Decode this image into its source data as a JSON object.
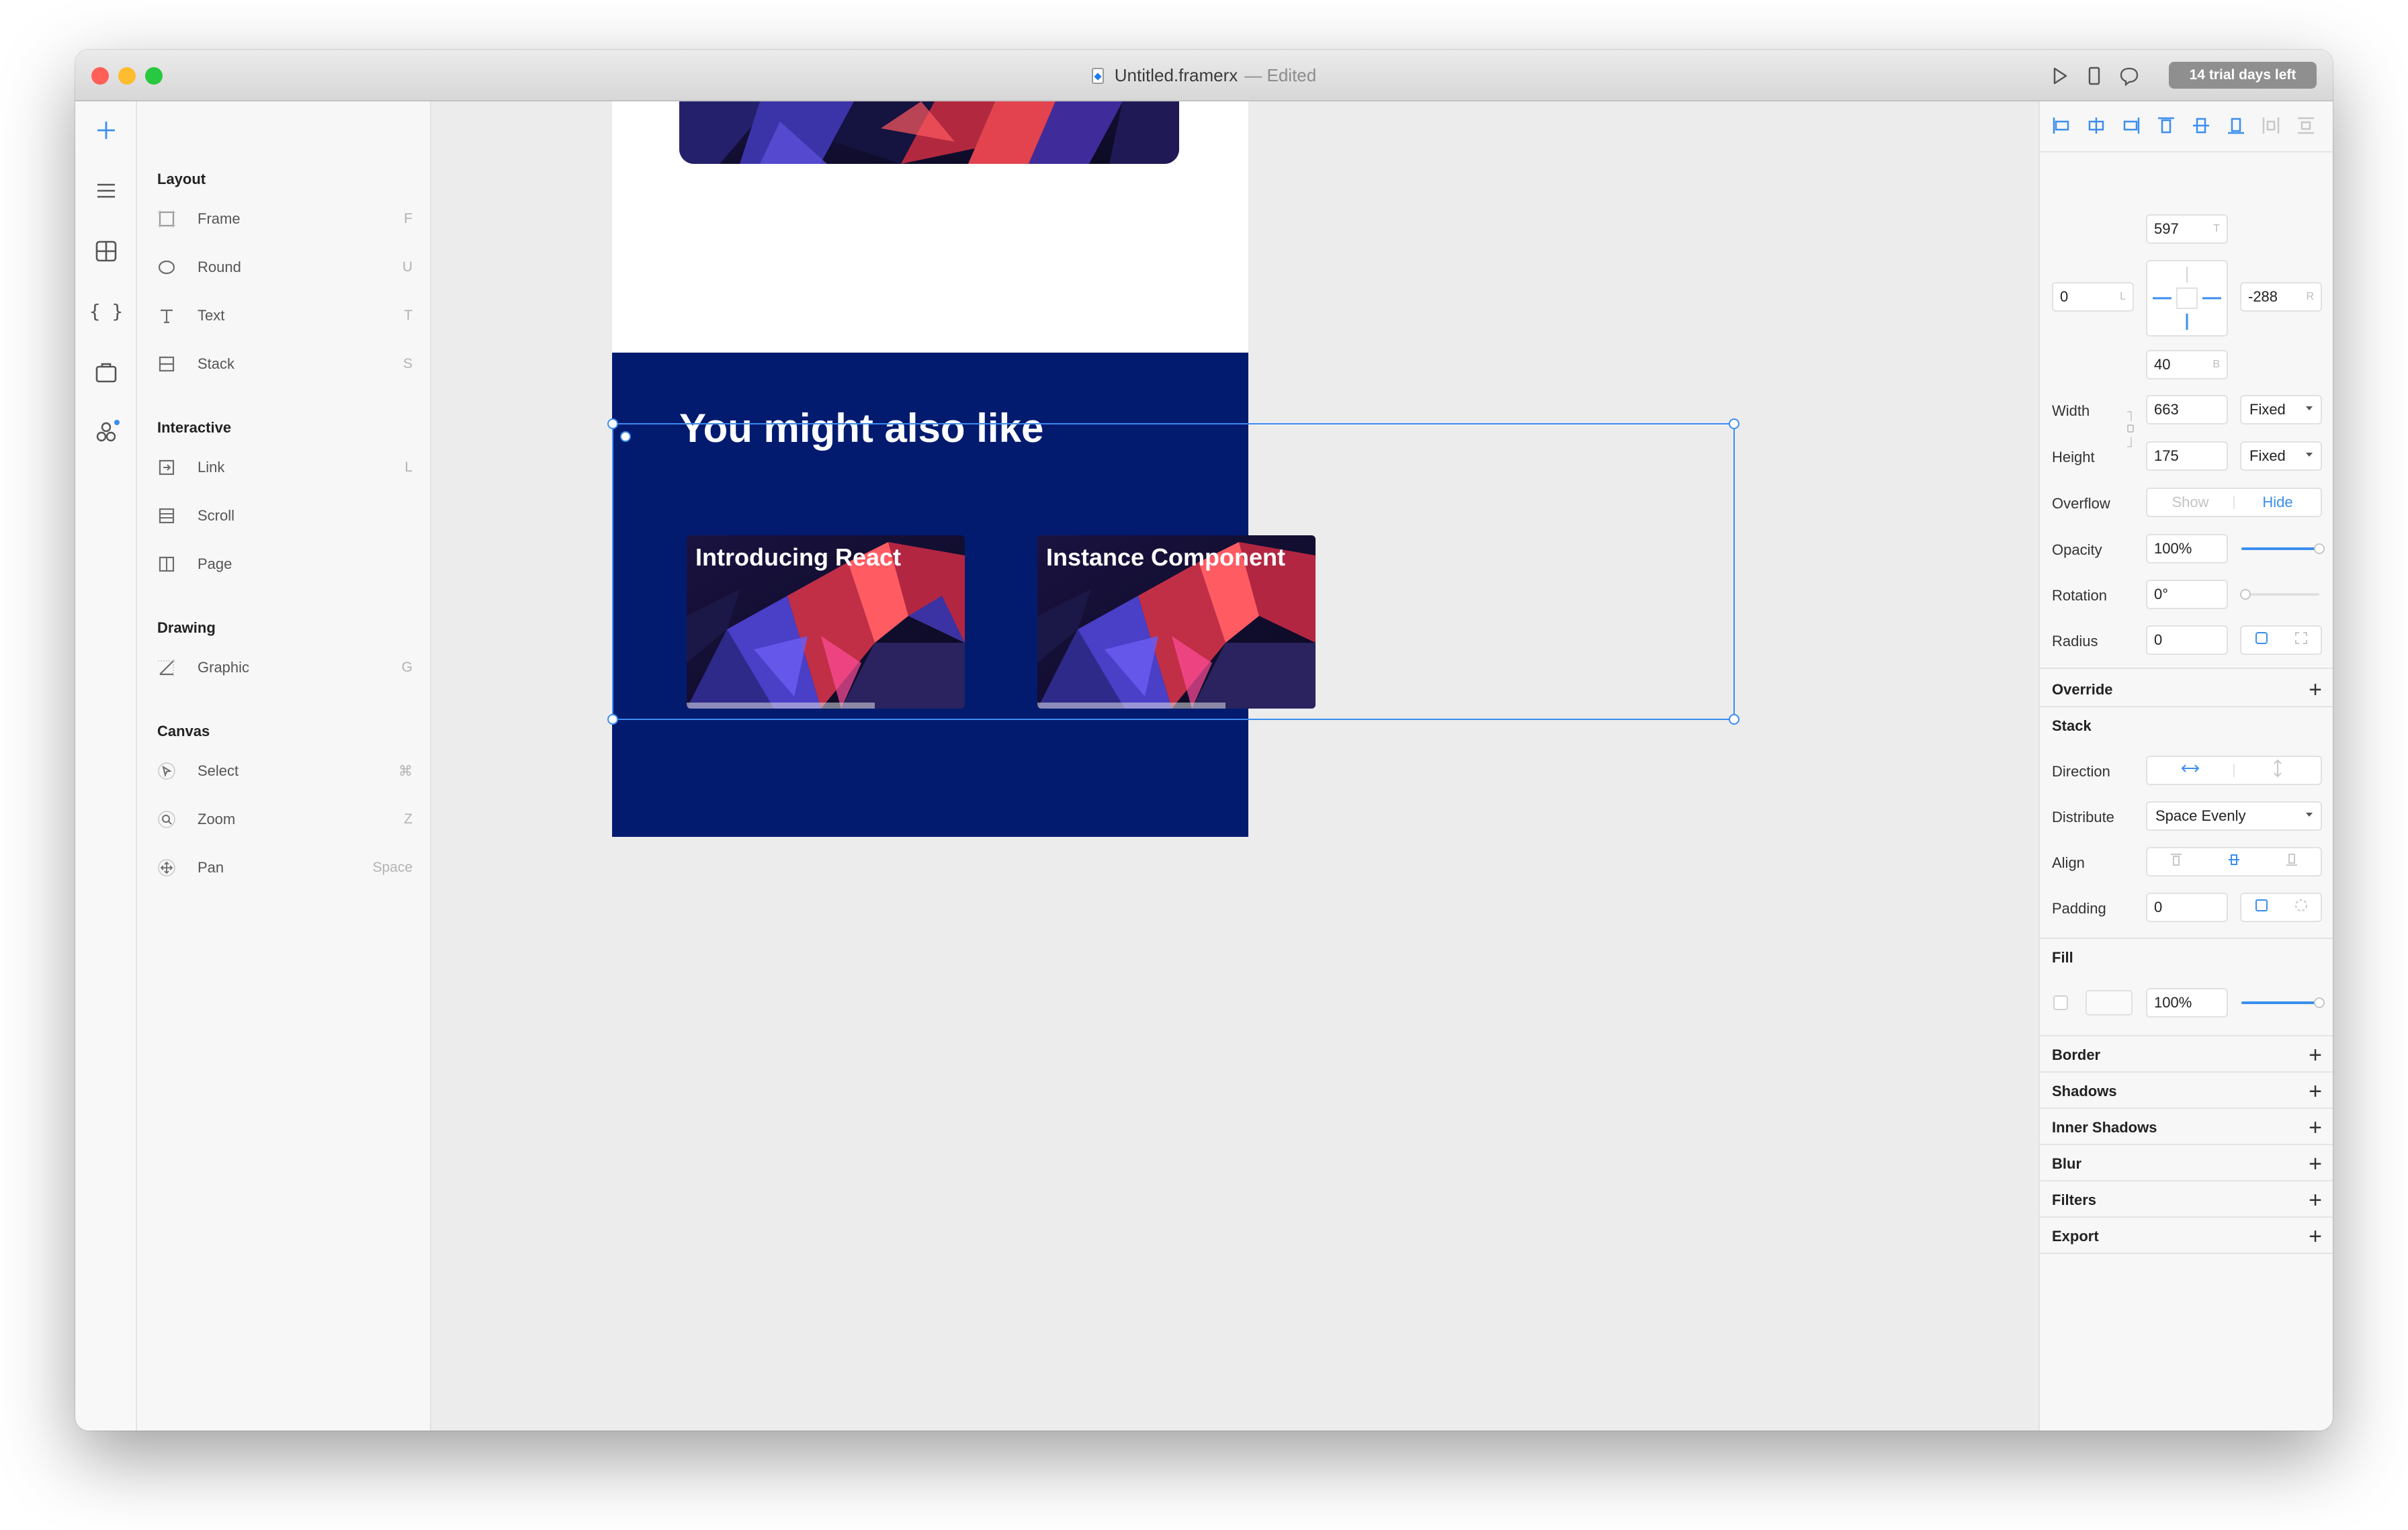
{
  "window": {
    "title": "Untitled.framerx",
    "title_suffix": "— Edited",
    "trial": "14 trial days left"
  },
  "toolbar_icons": [
    "play-icon",
    "device-icon",
    "comment-icon"
  ],
  "rail_icons": [
    "insert-icon",
    "layers-icon",
    "components-icon",
    "code-icon",
    "store-icon",
    "team-icon"
  ],
  "insert_panel": {
    "sections": [
      {
        "title": "Layout",
        "items": [
          {
            "label": "Frame",
            "key": "F"
          },
          {
            "label": "Round",
            "key": "U"
          },
          {
            "label": "Text",
            "key": "T"
          },
          {
            "label": "Stack",
            "key": "S"
          }
        ]
      },
      {
        "title": "Interactive",
        "items": [
          {
            "label": "Link",
            "key": "L"
          },
          {
            "label": "Scroll",
            "key": ""
          },
          {
            "label": "Page",
            "key": ""
          }
        ]
      },
      {
        "title": "Drawing",
        "items": [
          {
            "label": "Graphic",
            "key": "G"
          }
        ]
      },
      {
        "title": "Canvas",
        "items": [
          {
            "label": "Select",
            "key": "⌘"
          },
          {
            "label": "Zoom",
            "key": "Z"
          },
          {
            "label": "Pan",
            "key": "Space"
          }
        ]
      }
    ]
  },
  "canvas": {
    "section_title": "You might also like",
    "cards": [
      {
        "title": "Introducing React"
      },
      {
        "title": "Instance Component"
      }
    ]
  },
  "inspector": {
    "position": {
      "top": "597",
      "top_suffix": "T",
      "left": "0",
      "left_suffix": "L",
      "right": "-288",
      "right_suffix": "R",
      "bottom": "40",
      "bottom_suffix": "B"
    },
    "width": {
      "label": "Width",
      "value": "663",
      "mode": "Fixed"
    },
    "height": {
      "label": "Height",
      "value": "175",
      "mode": "Fixed"
    },
    "overflow": {
      "label": "Overflow",
      "show": "Show",
      "hide": "Hide",
      "selected": "Hide"
    },
    "opacity": {
      "label": "Opacity",
      "value": "100%",
      "level": 1.0
    },
    "rotation": {
      "label": "Rotation",
      "value": "0°",
      "level": 0.0
    },
    "radius": {
      "label": "Radius",
      "value": "0"
    },
    "override": "Override",
    "stack": {
      "title": "Stack",
      "direction": {
        "label": "Direction",
        "selected": "horizontal"
      },
      "distribute": {
        "label": "Distribute",
        "value": "Space Evenly"
      },
      "align": {
        "label": "Align",
        "selected": "center"
      },
      "padding": {
        "label": "Padding",
        "value": "0"
      }
    },
    "fill": {
      "title": "Fill",
      "value": "100%",
      "level": 1.0
    },
    "sections": [
      "Border",
      "Shadows",
      "Inner Shadows",
      "Blur",
      "Filters",
      "Export"
    ]
  },
  "colors": {
    "accent": "#3b8ef0",
    "section_bg": "#031b6f",
    "traffic_close": "#fe5f57",
    "traffic_min": "#febc2e",
    "traffic_max": "#28c840"
  }
}
